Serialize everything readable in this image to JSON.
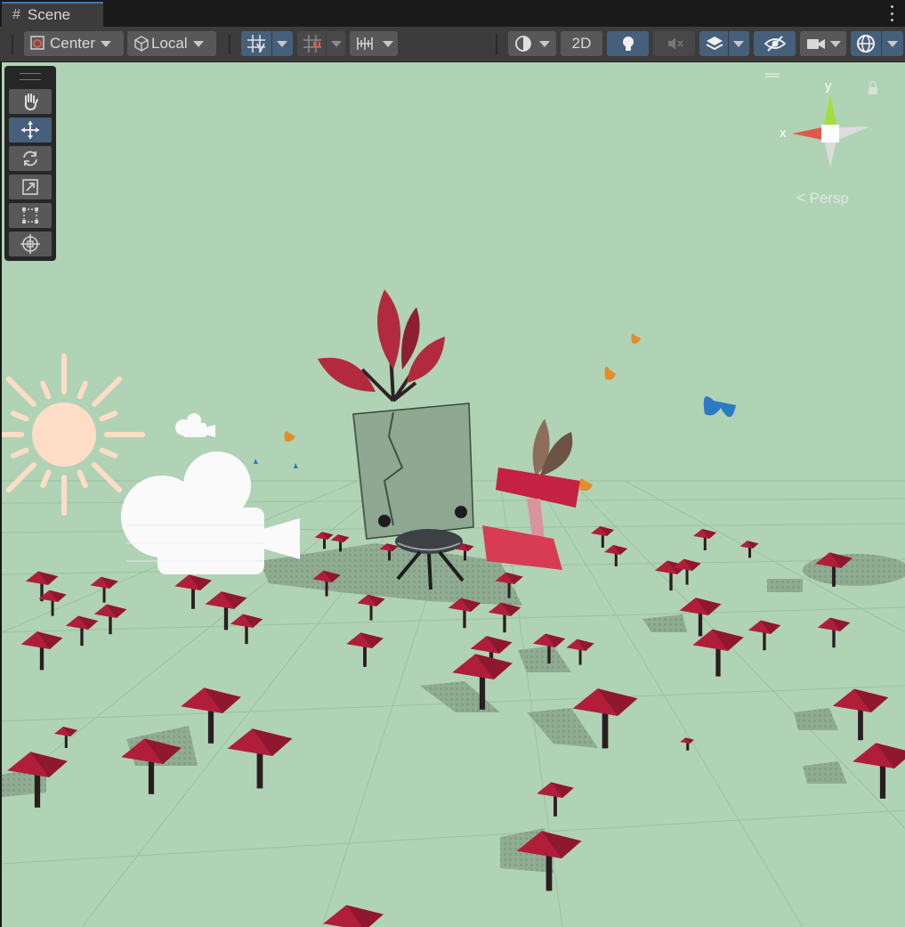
{
  "tab": {
    "icon": "hash-icon",
    "title": "Scene"
  },
  "toolbar": {
    "pivot_mode": "Center",
    "pivot_rotation": "Local",
    "mode_2d": "2D",
    "persp_label": "Persp"
  },
  "gizmo": {
    "x_label": "x",
    "y_label": "y"
  },
  "tools": [
    "view-tool",
    "move-tool",
    "rotate-tool",
    "scale-tool",
    "rect-tool",
    "transform-tool"
  ],
  "colors": {
    "viewport_bg": "#b0d3b5",
    "toolbar_bg": "#3c3c3c",
    "button_bg": "#585858",
    "active_bg": "#46607c",
    "tab_accent": "#3a79bb",
    "gizmo_x": "#e05a4a",
    "gizmo_y": "#9ad640",
    "mushroom": "#b01e3a"
  }
}
